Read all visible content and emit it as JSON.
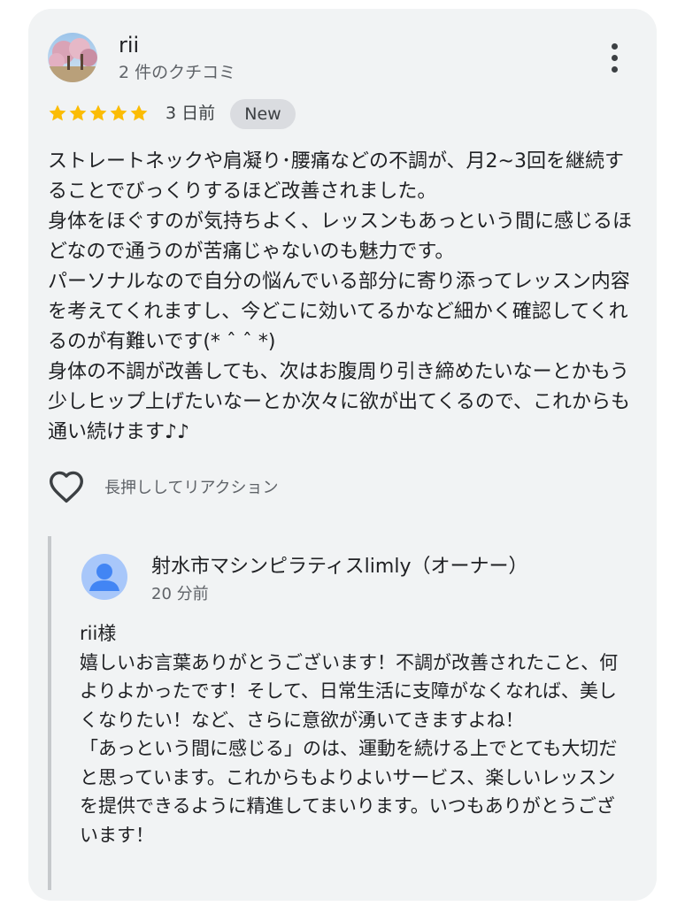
{
  "review": {
    "reviewer_name": "rii",
    "reviewer_meta": "2 件のクチコミ",
    "rating": 5,
    "star_color": "#fbbc04",
    "date": "3 日前",
    "badge": "New",
    "body": "ストレートネックや肩凝り･腰痛などの不調が、月2~3回を継続することでびっくりするほど改善されました。\n身体をほぐすのが気持ちよく、レッスンもあっという間に感じるほどなので通うのが苦痛じゃないのも魅力です。\nパーソナルなので自分の悩んでいる部分に寄り添ってレッスン内容を考えてくれますし、今どこに効いてるかなど細かく確認してくれるのが有難いです(* ˆ ˆ *)\n身体の不調が改善しても、次はお腹周り引き締めたいなーとかもう少しヒップ上げたいなーとか次々に欲が出てくるので、これからも通い続けます♪♪",
    "reaction_label": "長押ししてリアクション"
  },
  "owner_reply": {
    "name": "射水市マシンピラティスlimly（オーナー）",
    "date": "20 分前",
    "body": "rii様\n嬉しいお言葉ありがとうございます！不調が改善されたこと、何よりよかったです！そして、日常生活に支障がなくなれば、美しくなりたい！など、さらに意欲が湧いてきますよね！\n「あっという間に感じる」のは、運動を続ける上でとても大切だと思っています。これからもよりよいサービス、楽しいレッスンを提供できるように精進してまいります。いつもありがとうございます！"
  },
  "icons": {
    "menu": "more-vert-icon",
    "reaction": "heart-outline-icon",
    "owner_avatar": "person-icon"
  },
  "colors": {
    "card_bg": "#f1f3f4",
    "owner_avatar_bg": "#a8c7fa",
    "owner_avatar_fg": "#4285f4"
  }
}
